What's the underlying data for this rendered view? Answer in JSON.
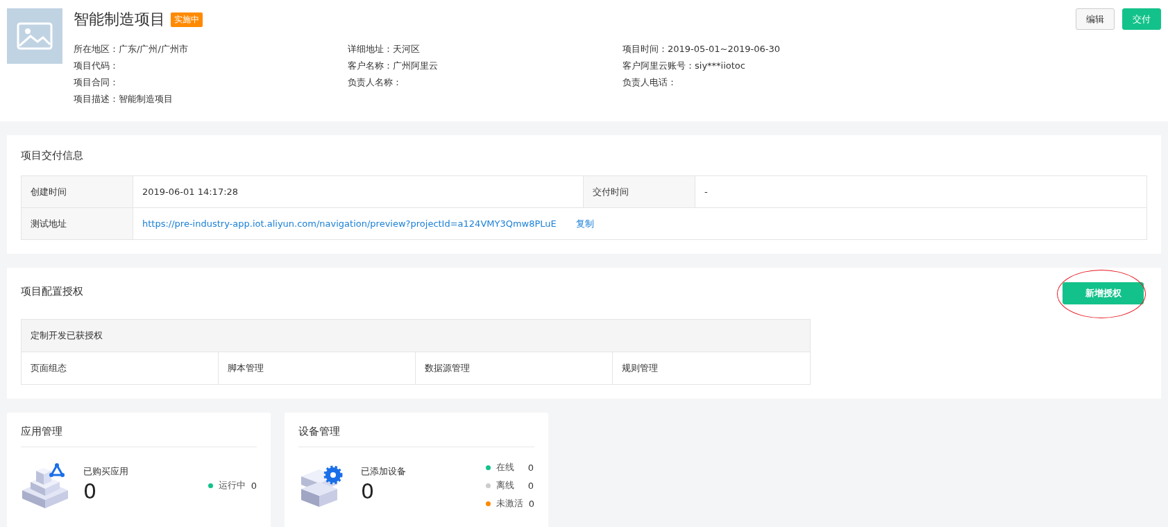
{
  "header": {
    "title": "智能制造项目",
    "status_badge": "实施中",
    "meta": [
      {
        "label": "所在地区：",
        "value": "广东/广州/广州市"
      },
      {
        "label": "详细地址：",
        "value": "天河区"
      },
      {
        "label": "项目时间：",
        "value": "2019-05-01~2019-06-30"
      },
      {
        "label": "项目代码："
      },
      {
        "label": "客户名称：",
        "value": "广州阿里云"
      },
      {
        "label": "客户阿里云账号：",
        "value": "siy***iiotoc"
      },
      {
        "label": "项目合同："
      },
      {
        "label": "负责人名称："
      },
      {
        "label": "负责人电话："
      },
      {
        "label": "项目描述：",
        "value": "智能制造项目"
      }
    ],
    "buttons": [
      {
        "label": "编辑",
        "kind": "default"
      },
      {
        "label": "交付",
        "kind": "primary"
      }
    ]
  },
  "delivery_info": {
    "title": "项目交付信息",
    "created_label": "创建时间",
    "created_value": "2019-06-01 14:17:28",
    "delivered_label": "交付时间",
    "delivered_value": "-",
    "test_url_label": "测试地址",
    "test_url": "https://pre-industry-app.iot.aliyun.com/navigation/preview?projectId=a124VMY3Qmw8PLuE",
    "copy_link": "复制"
  },
  "config_auth": {
    "title": "项目配置授权",
    "add_button": {
      "label": "新增授权",
      "circled": true
    },
    "table_header": "定制开发已获授权",
    "items": [
      "页面组态",
      "脚本管理",
      "数据源管理",
      "规则管理"
    ]
  },
  "cards": [
    {
      "kind": "app",
      "title": "应用管理",
      "label": "已购买应用",
      "count": "0",
      "statuses": [
        {
          "label": "运行中",
          "count": "0",
          "color": "#13c28a"
        }
      ]
    },
    {
      "kind": "device",
      "title": "设备管理",
      "label": "已添加设备",
      "count": "0",
      "statuses": [
        {
          "label": "在线",
          "count": "0",
          "color": "#13c28a"
        },
        {
          "label": "离线",
          "count": "0",
          "color": "#cccccc"
        },
        {
          "label": "未激活",
          "count": "0",
          "color": "#ff8a00"
        }
      ]
    }
  ]
}
